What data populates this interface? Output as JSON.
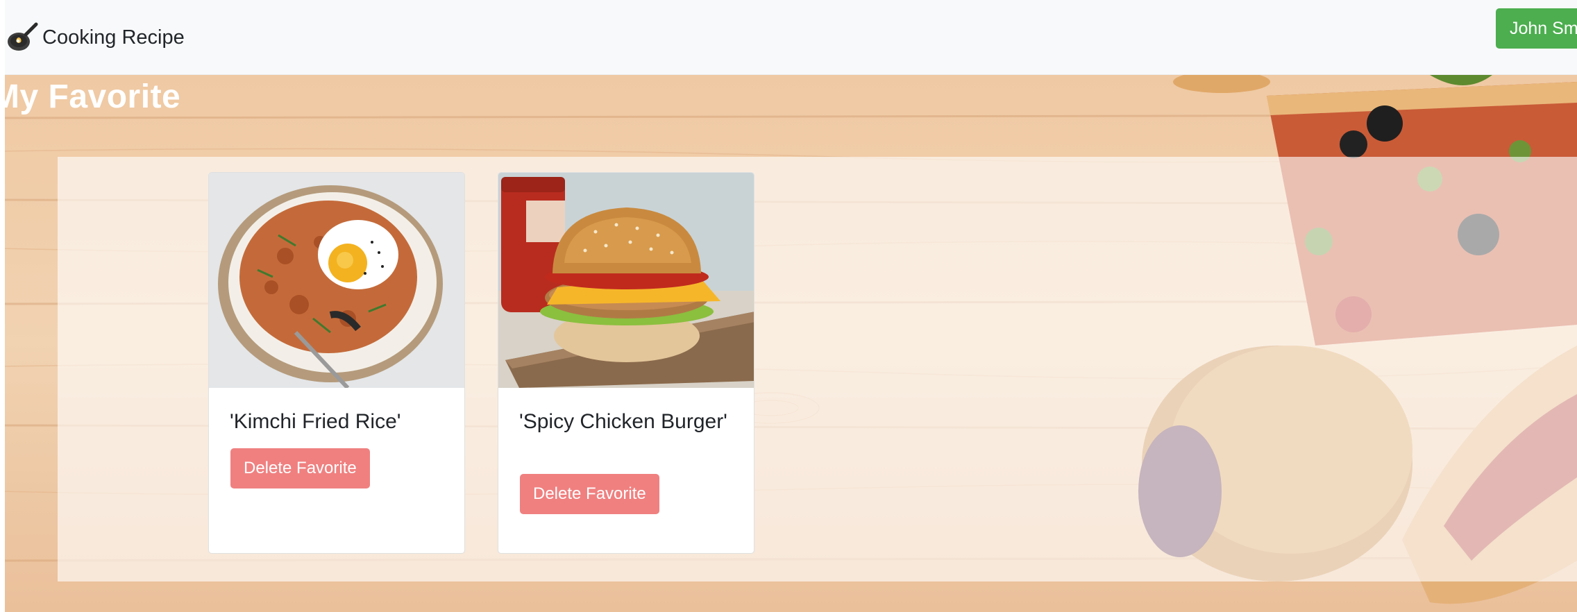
{
  "navbar": {
    "brand_text": "Cooking Recipe",
    "brand_icon": "frying-pan-icon",
    "user_button_label": "John Smith",
    "user_button_color": "#4cae4f"
  },
  "page": {
    "title": "My Favorite"
  },
  "favorites": [
    {
      "title": "'Kimchi Fried Rice'",
      "delete_label": "Delete Favorite",
      "image": "kimchi-fried-rice-photo"
    },
    {
      "title": "'Spicy Chicken Burger'",
      "delete_label": "Delete Favorite",
      "image": "spicy-chicken-burger-photo"
    }
  ],
  "colors": {
    "delete_button": "#f08080",
    "navbar_bg": "#f8f9fa"
  }
}
